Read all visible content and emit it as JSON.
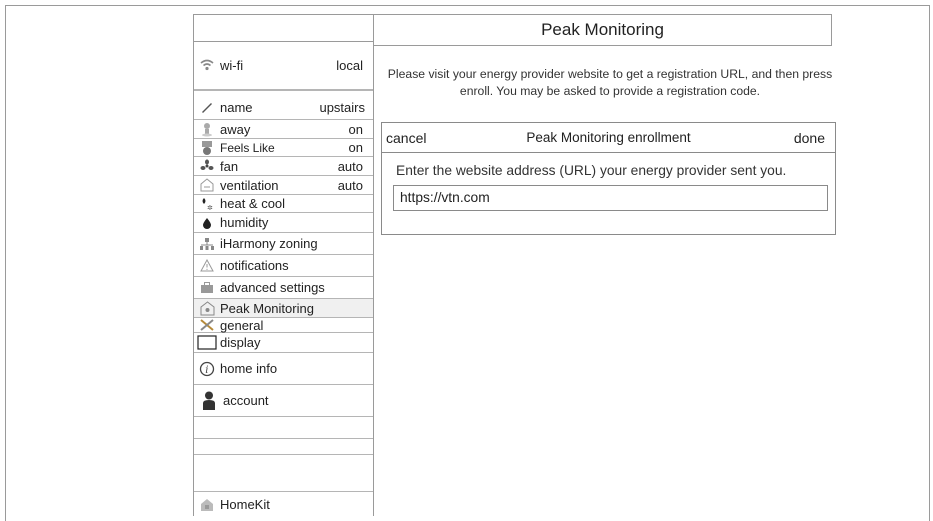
{
  "header": {
    "title": "Peak Monitoring"
  },
  "sidebar": {
    "items": [
      {
        "label": "wi-fi",
        "value": "local",
        "icon": "wifi-icon"
      },
      {
        "label": "name",
        "value": "upstairs",
        "icon": "pencil-icon"
      },
      {
        "label": "away",
        "value": "on",
        "icon": "person-pin-icon"
      },
      {
        "label": "Feels Like",
        "value": "on",
        "icon": "feels-like-icon"
      },
      {
        "label": "fan",
        "value": "auto",
        "icon": "fan-icon"
      },
      {
        "label": "ventilation",
        "value": "auto",
        "icon": "house-vent-icon"
      },
      {
        "label": "heat & cool",
        "value": "",
        "icon": "flame-snowflake-icon"
      },
      {
        "label": "humidity",
        "value": "",
        "icon": "droplet-icon"
      },
      {
        "label": "iHarmony zoning",
        "value": "",
        "icon": "zoning-icon"
      },
      {
        "label": "notifications",
        "value": "",
        "icon": "warning-icon"
      },
      {
        "label": "advanced settings",
        "value": "",
        "icon": "toolbox-icon"
      },
      {
        "label": "Peak Monitoring",
        "value": "",
        "icon": "peak-house-icon"
      },
      {
        "label": "general",
        "value": "",
        "icon": "tools-icon"
      },
      {
        "label": "display",
        "value": "",
        "icon": "display-icon"
      },
      {
        "label": "home info",
        "value": "",
        "icon": "info-icon"
      },
      {
        "label": "account",
        "value": "",
        "icon": "user-icon"
      },
      {
        "label": "HomeKit",
        "value": "",
        "icon": "homekit-icon"
      }
    ]
  },
  "main": {
    "intro": "Please visit your energy provider website to get a registration URL, and then press enroll. You may be asked to provide a registration code.",
    "enrollment": {
      "cancel_label": "cancel",
      "title": "Peak Monitoring enrollment",
      "done_label": "done",
      "prompt": "Enter the website address (URL) your energy provider sent you.",
      "url_value": "https://vtn.com"
    }
  }
}
